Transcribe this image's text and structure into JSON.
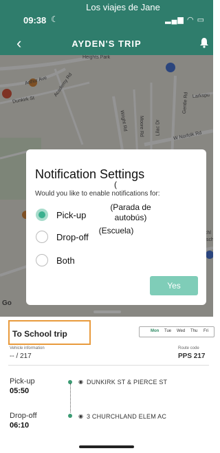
{
  "status_bar": {
    "time": "09:38"
  },
  "caption_top": "Los viajes de Jane",
  "nav": {
    "title": "AYDEN'S TRIP"
  },
  "map": {
    "labels": {
      "heights_park": "Heights Park",
      "arthur_ave": "Arthur Ave",
      "academy_rd": "Academy Rd",
      "dunkirk_st": "Dunkirk St",
      "wright_rd": "Wright Rd",
      "moore_rd": "Moore Rd",
      "lilac_dr": "Lilac Dr",
      "gentle_rd": "Gentle Rd",
      "larkspur": "Larkspu",
      "norfolk_rd": "W Norfolk Rd",
      "chl": "chl",
      "sch": "sch"
    },
    "google_mark": "Go"
  },
  "modal": {
    "title": "Notification Settings",
    "subtitle": "Would you like to enable notifications for:",
    "options": [
      {
        "label": "Pick-up",
        "selected": true
      },
      {
        "label": "Drop-off",
        "selected": false
      },
      {
        "label": "Both",
        "selected": false
      }
    ],
    "confirm_label": "Yes"
  },
  "annotations": {
    "paren": "(",
    "pickup_note_line1": "(Parada de",
    "pickup_note_line2": "autobús)",
    "dropoff_note": "(Escuela)"
  },
  "trip": {
    "title": "To School trip",
    "days": [
      {
        "label": "Mon",
        "active": true
      },
      {
        "label": "Tue",
        "active": false
      },
      {
        "label": "Wed",
        "active": false
      },
      {
        "label": "Thu",
        "active": false
      },
      {
        "label": "Fri",
        "active": false
      }
    ],
    "vehicle_info_label": "Vehicle information",
    "vehicle_info_value": "-- / 217",
    "route_code_label": "Route code",
    "route_code_value": "PPS 217",
    "stops": [
      {
        "type": "Pick-up",
        "time": "05:50",
        "name": "DUNKIRK ST & PIERCE ST"
      },
      {
        "type": "Drop-off",
        "time": "06:10",
        "name": "3 CHURCHLAND ELEM AC"
      }
    ]
  },
  "colors": {
    "header": "#2f7d6c",
    "accent": "#3bb08f",
    "highlight_box": "#e89a3c"
  }
}
